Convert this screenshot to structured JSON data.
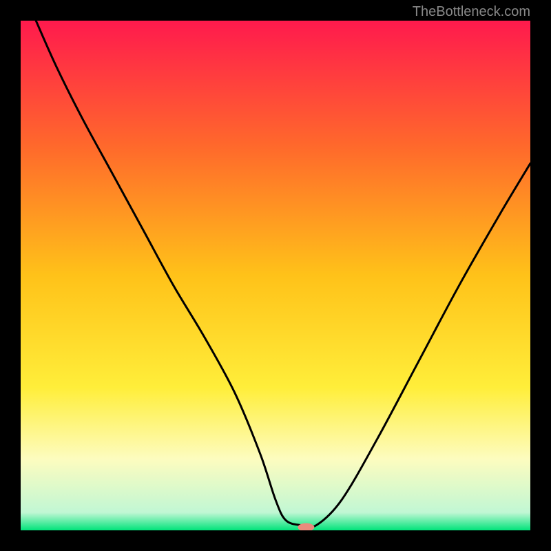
{
  "attribution": "TheBottleneck.com",
  "chart_data": {
    "type": "line",
    "title": "",
    "xlabel": "",
    "ylabel": "",
    "xlim": [
      0,
      100
    ],
    "ylim": [
      0,
      100
    ],
    "grid": false,
    "legend": false,
    "background_gradient": {
      "stops": [
        {
          "pos": 0.0,
          "color": "#ff1a4d"
        },
        {
          "pos": 0.25,
          "color": "#ff6a2b"
        },
        {
          "pos": 0.5,
          "color": "#ffc219"
        },
        {
          "pos": 0.72,
          "color": "#ffee3a"
        },
        {
          "pos": 0.86,
          "color": "#fdfcbf"
        },
        {
          "pos": 0.965,
          "color": "#c1f7d4"
        },
        {
          "pos": 1.0,
          "color": "#00e37a"
        }
      ]
    },
    "series": [
      {
        "name": "bottleneck-curve",
        "color": "#000000",
        "x": [
          3,
          7,
          12,
          18,
          24,
          30,
          36,
          42,
          47,
          50,
          52,
          55,
          58,
          63,
          70,
          78,
          86,
          94,
          100
        ],
        "y": [
          100,
          91,
          81,
          70,
          59,
          48,
          38,
          27,
          15,
          6,
          2,
          1,
          1,
          6,
          18,
          33,
          48,
          62,
          72
        ]
      }
    ],
    "marker": {
      "name": "optimal-point",
      "x": 56,
      "y": 0.6,
      "color": "#e98b7d",
      "rx": 12,
      "ry": 6
    }
  }
}
